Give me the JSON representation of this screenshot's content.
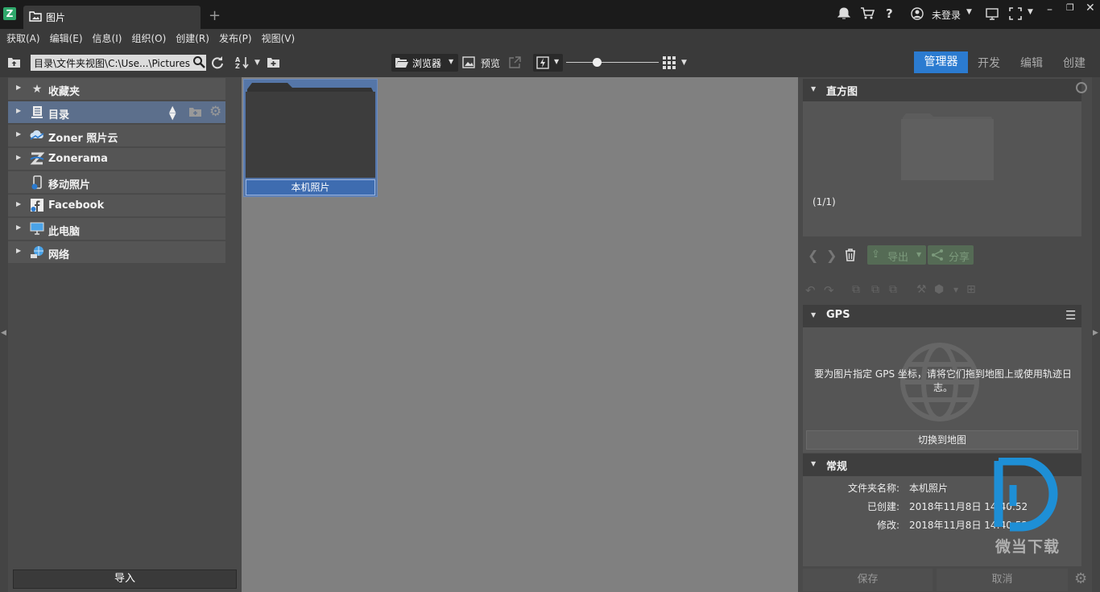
{
  "window": {
    "tab_title": "图片",
    "user_label": "未登录"
  },
  "menu": [
    "获取(A)",
    "编辑(E)",
    "信息(I)",
    "组织(O)",
    "创建(R)",
    "发布(P)",
    "视图(V)"
  ],
  "toolbar": {
    "path": "目录\\文件夹视图\\C:\\Use...\\Pictures",
    "browser_label": "浏览器",
    "preview_label": "预览",
    "modes": [
      "管理器",
      "开发",
      "编辑",
      "创建"
    ]
  },
  "nav": [
    {
      "label": "收藏夹"
    },
    {
      "label": "目录"
    },
    {
      "label": "Zoner 照片云"
    },
    {
      "label": "Zonerama"
    },
    {
      "label": "移动照片"
    },
    {
      "label": "Facebook"
    },
    {
      "label": "此电脑"
    },
    {
      "label": "网络"
    }
  ],
  "import_label": "导入",
  "folder": {
    "label": "本机照片"
  },
  "histogram": {
    "title": "直方图",
    "count": "(1/1)"
  },
  "actions": {
    "export_label": "导出",
    "share_label": "分享"
  },
  "gps": {
    "title": "GPS",
    "message": "要为图片指定 GPS 坐标，请将它们拖到地图上或使用轨迹日志。",
    "switch_label": "切换到地图"
  },
  "general": {
    "title": "常规",
    "rows": [
      {
        "key": "文件夹名称:",
        "value": "本机照片"
      },
      {
        "key": "已创建:",
        "value": "2018年11月8日 14:40:52"
      },
      {
        "key": "修改:",
        "value": "2018年11月8日 14:40:52"
      }
    ]
  },
  "footer": {
    "save_label": "保存",
    "cancel_label": "取消"
  },
  "watermark": {
    "text": "微当下载"
  },
  "colors": {
    "accent": "#2b7bd0",
    "selection": "#5c6f8c"
  }
}
